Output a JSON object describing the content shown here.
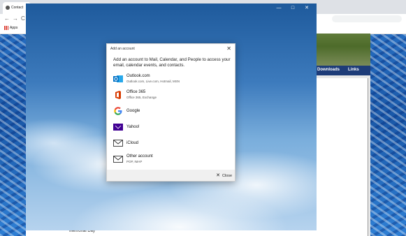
{
  "browser": {
    "tab_title": "Contact",
    "nav_back": "←",
    "nav_forward": "→",
    "nav_reload": "C",
    "bookmarks_apps": "Apps"
  },
  "website": {
    "nav_downloads": "Downloads",
    "nav_links": "Links",
    "footer_text": "Memorial Day"
  },
  "app_window": {
    "minimize": "—",
    "maximize": "□",
    "close": "✕"
  },
  "dialog": {
    "title": "Add an account",
    "close_icon": "✕",
    "description": "Add an account to Mail, Calendar, and People to access your email, calendar events, and contacts.",
    "accounts": [
      {
        "name": "Outlook.com",
        "sub": "Outlook.com, Live.com, Hotmail, MSN",
        "icon": "outlook-icon"
      },
      {
        "name": "Office 365",
        "sub": "Office 365, Exchange",
        "icon": "office365-icon"
      },
      {
        "name": "Google",
        "sub": "",
        "icon": "google-icon"
      },
      {
        "name": "Yahoo!",
        "sub": "",
        "icon": "yahoo-icon"
      },
      {
        "name": "iCloud",
        "sub": "",
        "icon": "mail-envelope-icon"
      },
      {
        "name": "Other account",
        "sub": "POP, IMAP",
        "icon": "mail-envelope-icon"
      }
    ],
    "close_label": "Close"
  },
  "colors": {
    "outlook_blue": "#0072c6",
    "office_red": "#d83b01",
    "yahoo_purple": "#410093",
    "site_nav": "#1e3c78"
  }
}
